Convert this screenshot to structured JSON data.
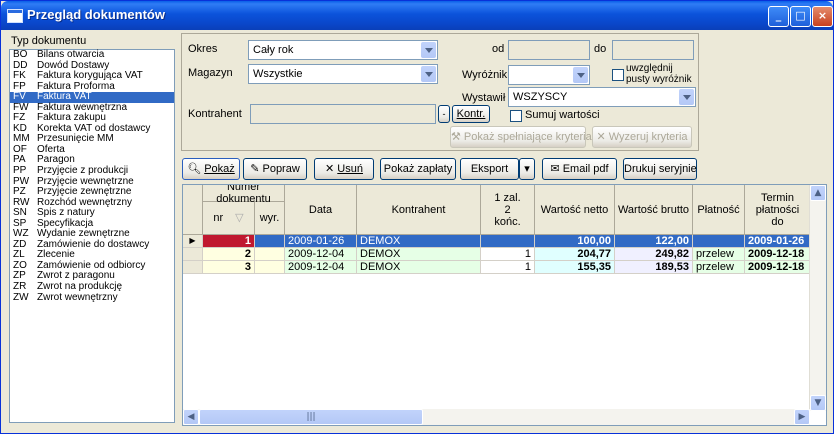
{
  "window": {
    "title": "Przegląd dokumentów"
  },
  "left": {
    "label": "Typ dokumentu",
    "items": [
      {
        "code": "BO",
        "name": "Bilans otwarcia"
      },
      {
        "code": "DD",
        "name": "Dowód Dostawy"
      },
      {
        "code": "FK",
        "name": "Faktura korygująca VAT"
      },
      {
        "code": "FP",
        "name": "Faktura Proforma"
      },
      {
        "code": "FV",
        "name": "Faktura VAT"
      },
      {
        "code": "FW",
        "name": "Faktura wewnętrzna"
      },
      {
        "code": "FZ",
        "name": "Faktura zakupu"
      },
      {
        "code": "KD",
        "name": "Korekta VAT od dostawcy"
      },
      {
        "code": "MM",
        "name": "Przesunięcie MM"
      },
      {
        "code": "OF",
        "name": "Oferta"
      },
      {
        "code": "PA",
        "name": "Paragon"
      },
      {
        "code": "PP",
        "name": "Przyjęcie z produkcji"
      },
      {
        "code": "PW",
        "name": "Przyjęcie wewnętrzne"
      },
      {
        "code": "PZ",
        "name": "Przyjęcie zewnętrzne"
      },
      {
        "code": "RW",
        "name": "Rozchód wewnętrzny"
      },
      {
        "code": "SN",
        "name": "Spis z natury"
      },
      {
        "code": "SP",
        "name": "Specyfikacja"
      },
      {
        "code": "WZ",
        "name": "Wydanie zewnętrzne"
      },
      {
        "code": "ZD",
        "name": "Zamówienie do dostawcy"
      },
      {
        "code": "ZL",
        "name": "Zlecenie"
      },
      {
        "code": "ZO",
        "name": "Zamówienie od odbiorcy"
      },
      {
        "code": "ZP",
        "name": "Zwrot z paragonu"
      },
      {
        "code": "ZR",
        "name": "Zwrot na produkcję"
      },
      {
        "code": "ZW",
        "name": "Zwrot wewnętrzny"
      }
    ]
  },
  "filters": {
    "okres_label": "Okres",
    "okres_value": "Cały rok",
    "magazyn_label": "Magazyn",
    "magazyn_value": "Wszystkie",
    "od_label": "od",
    "do_label": "do",
    "wyroznik_label": "Wyróżnik",
    "wyroznik_value": "",
    "uwzglednij_label": "uwzględnij pusty wyróżnik",
    "wystawil_label": "Wystawił",
    "wystawil_value": "WSZYSCY",
    "sumuj_label": "Sumuj wartości",
    "kontrahent_label": "Kontrahent",
    "kontrahent_value": "",
    "kontr_button": "Kontr.",
    "pokaz_spelniajace": "Pokaż spełniające kryteria",
    "wyzeruj": "Wyzeruj kryteria"
  },
  "toolbar": {
    "pokaz": "Pokaż",
    "popraw": "Popraw",
    "usun": "Usuń",
    "pokaz_zaplaty": "Pokaż zapłaty",
    "eksport": "Eksport",
    "email_pdf": "Email pdf",
    "drukuj": "Drukuj seryjnie"
  },
  "grid": {
    "headers": {
      "numer": "Numer dokumentu",
      "nr": "nr",
      "wyr": "wyr.",
      "data": "Data",
      "kontrahent": "Kontrahent",
      "zal": "1 zal. 2 końc.",
      "netto": "Wartość netto",
      "brutto": "Wartość brutto",
      "platnosc": "Płatność",
      "termin": "Termin płatności do"
    },
    "rows": [
      {
        "nr": "1",
        "wyr": "",
        "data": "2009-01-26",
        "kontrahent": "DEMOX",
        "zal": "",
        "netto": "100,00",
        "brutto": "122,00",
        "platnosc": "",
        "termin": "2009-01-26"
      },
      {
        "nr": "2",
        "wyr": "",
        "data": "2009-12-04",
        "kontrahent": "DEMOX",
        "zal": "1",
        "netto": "204,77",
        "brutto": "249,82",
        "platnosc": "przelew",
        "termin": "2009-12-18"
      },
      {
        "nr": "3",
        "wyr": "",
        "data": "2009-12-04",
        "kontrahent": "DEMOX",
        "zal": "1",
        "netto": "155,35",
        "brutto": "189,53",
        "platnosc": "przelew",
        "termin": "2009-12-18"
      }
    ]
  }
}
